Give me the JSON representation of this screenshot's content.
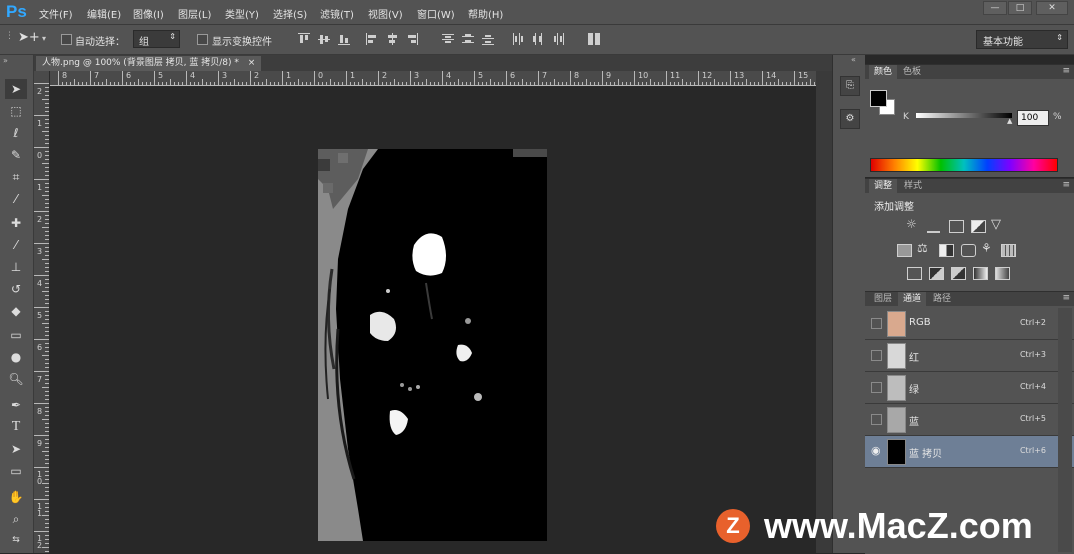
{
  "app": {
    "logo": "Ps"
  },
  "menu": [
    "文件(F)",
    "编辑(E)",
    "图像(I)",
    "图层(L)",
    "类型(Y)",
    "选择(S)",
    "滤镜(T)",
    "视图(V)",
    "窗口(W)",
    "帮助(H)"
  ],
  "window_controls": [
    "—",
    "□",
    "✕"
  ],
  "options": {
    "auto_select_label": "自动选择：",
    "auto_select_value": "组",
    "show_transform_label": "显示变换控件",
    "workspace": "基本功能"
  },
  "document": {
    "tab_title": "人物.png @ 100% (背景图层 拷贝, 蓝 拷贝/8) *",
    "tab_close": "×"
  },
  "rulers": {
    "h_labels": [
      "8",
      "7",
      "6",
      "5",
      "4",
      "3",
      "2",
      "1",
      "0",
      "1",
      "2",
      "3",
      "4",
      "5",
      "6",
      "7",
      "8",
      "9",
      "10",
      "11",
      "12",
      "13",
      "14",
      "15"
    ],
    "v_labels": [
      "2",
      "1",
      "0",
      "1",
      "2",
      "3",
      "4",
      "5",
      "6",
      "7",
      "8",
      "9",
      "1 0",
      "1 1",
      "1 2"
    ]
  },
  "color_panel": {
    "tabs": [
      "颜色",
      "色板"
    ],
    "channel_label": "K",
    "value": "100",
    "unit": "%"
  },
  "adjust_panel": {
    "tabs": [
      "调整",
      "样式"
    ],
    "title": "添加调整"
  },
  "channels_panel": {
    "tabs": [
      "图层",
      "通道",
      "路径"
    ],
    "rows": [
      {
        "name": "RGB",
        "shortcut": "Ctrl+2",
        "visible": false,
        "selected": false
      },
      {
        "name": "红",
        "shortcut": "Ctrl+3",
        "visible": false,
        "selected": false
      },
      {
        "name": "绿",
        "shortcut": "Ctrl+4",
        "visible": false,
        "selected": false
      },
      {
        "name": "蓝",
        "shortcut": "Ctrl+5",
        "visible": false,
        "selected": false
      },
      {
        "name": "蓝 拷贝",
        "shortcut": "Ctrl+6",
        "visible": true,
        "selected": true
      }
    ]
  },
  "watermark": {
    "logo": "Z",
    "text": "www.MacZ.com"
  },
  "colors": {
    "accent": "#31a8ff",
    "selected_row": "#6e7f96",
    "watermark_logo": "#e8612c"
  }
}
